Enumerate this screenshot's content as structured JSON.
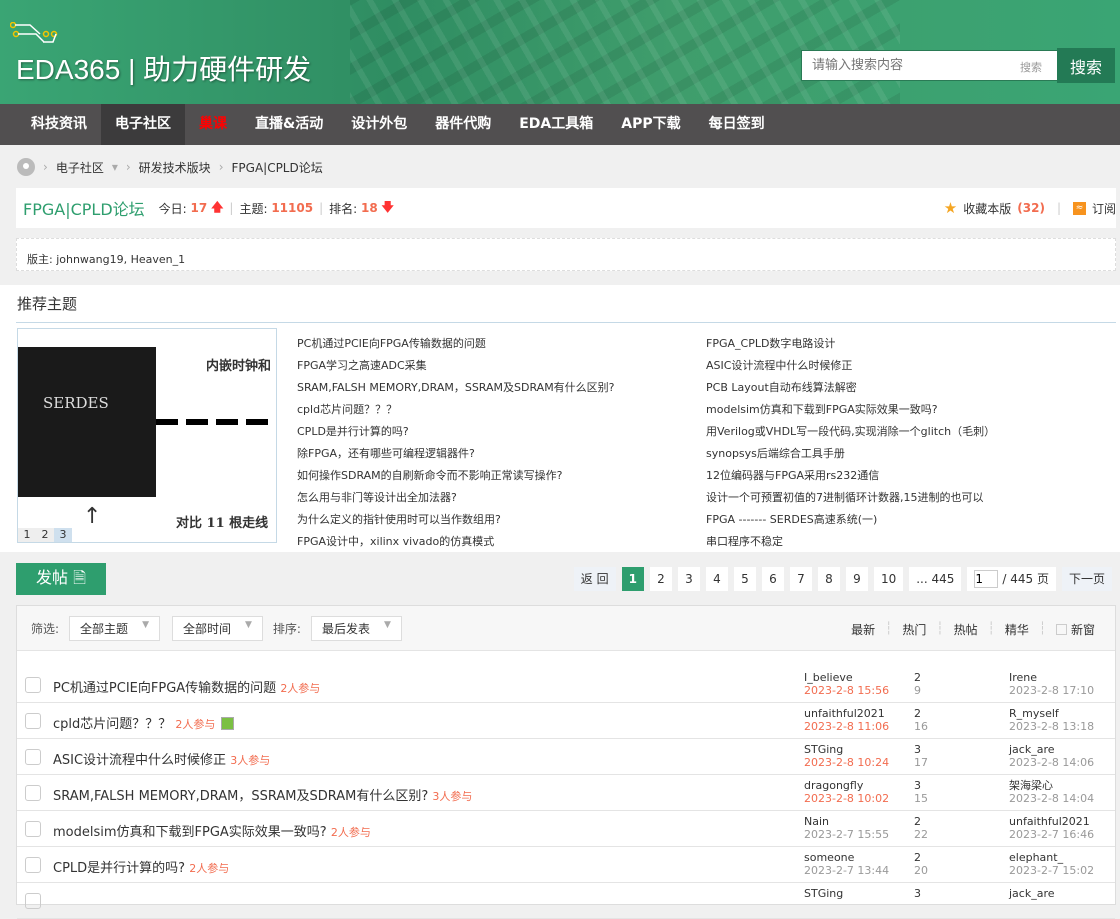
{
  "header": {
    "logo": "EDA365 | 助力硬件研发",
    "search_placeholder": "请输入搜索内容",
    "search_mini": "搜索",
    "search_button": "搜索"
  },
  "nav": [
    "科技资讯",
    "电子社区",
    "巢课",
    "直播&活动",
    "设计外包",
    "器件代购",
    "EDA工具箱",
    "APP下载",
    "每日签到"
  ],
  "breadcrumb": [
    "电子社区",
    "研发技术版块",
    "FPGA|CPLD论坛"
  ],
  "forum": {
    "title": "FPGA|CPLD论坛",
    "today_label": "今日:",
    "today": "17",
    "topics_label": "主题:",
    "topics": "11105",
    "rank_label": "排名:",
    "rank": "18",
    "fav": "收藏本版",
    "fav_count": "(32)",
    "subscribe": "订阅",
    "moderators": "版主: johnwang19, Heaven_1"
  },
  "recommend": {
    "title": "推荐主题",
    "img_text1": "SERDES",
    "img_text2": "内嵌时钟和",
    "img_text3": "对比 11 根走线",
    "img_pages": [
      "1",
      "2",
      "3"
    ],
    "col1": [
      "PC机通过PCIE向FPGA传输数据的问题",
      "FPGA学习之高速ADC采集",
      "SRAM,FALSH MEMORY,DRAM，SSRAM及SDRAM有什么区别?",
      "cpld芯片问题？？？",
      "CPLD是并行计算的吗?",
      "除FPGA，还有哪些可编程逻辑器件?",
      "如何操作SDRAM的自刷新命令而不影响正常读写操作?",
      "怎么用与非门等设计出全加法器?",
      "为什么定义的指针使用时可以当作数组用?",
      "FPGA设计中，xilinx vivado的仿真模式"
    ],
    "col2": [
      "FPGA_CPLD数字电路设计",
      "ASIC设计流程中什么时候修正",
      "PCB Layout自动布线算法解密",
      "modelsim仿真和下载到FPGA实际效果一致吗?",
      "用Verilog或VHDL写一段代码,实现消除一个glitch（毛刺）",
      "synopsys后端综合工具手册",
      "12位编码器与FPGA采用rs232通信",
      "设计一个可预置初值的7进制循环计数器,15进制的也可以",
      "FPGA ------- SERDES高速系统(一)",
      "串口程序不稳定"
    ]
  },
  "post_button": "发帖",
  "pagination": {
    "back": "返 回",
    "pages": [
      "1",
      "2",
      "3",
      "4",
      "5",
      "6",
      "7",
      "8",
      "9",
      "10",
      "... 445"
    ],
    "input": "1",
    "total": "/ 445 页",
    "next": "下一页"
  },
  "filter": {
    "label": "筛选:",
    "type": "全部主题",
    "time": "全部时间",
    "sort_label": "排序:",
    "sort": "最后发表",
    "tabs": [
      "最新",
      "热门",
      "热帖",
      "精华"
    ],
    "newwin": "新窗"
  },
  "threads": [
    {
      "title": "PC机通过PCIE向FPGA传输数据的问题",
      "part": "2人参与",
      "author": "I_believe",
      "date": "2023-2-8 15:56",
      "new": true,
      "replies": "2",
      "views": "9",
      "last": "Irene",
      "last_date": "2023-2-8 17:10"
    },
    {
      "title": "cpld芯片问题？？？",
      "part": "2人参与",
      "img": true,
      "author": "unfaithful2021",
      "date": "2023-2-8 11:06",
      "new": true,
      "replies": "2",
      "views": "16",
      "last": "R_myself",
      "last_date": "2023-2-8 13:18"
    },
    {
      "title": "ASIC设计流程中什么时候修正",
      "part": "3人参与",
      "author": "STGing",
      "date": "2023-2-8 10:24",
      "new": true,
      "replies": "3",
      "views": "17",
      "last": "jack_are",
      "last_date": "2023-2-8 14:06"
    },
    {
      "title": "SRAM,FALSH MEMORY,DRAM，SSRAM及SDRAM有什么区别?",
      "part": "3人参与",
      "author": "dragongfly",
      "date": "2023-2-8 10:02",
      "new": true,
      "replies": "3",
      "views": "15",
      "last": "架海梁心",
      "last_date": "2023-2-8 14:04"
    },
    {
      "title": "modelsim仿真和下载到FPGA实际效果一致吗?",
      "part": "2人参与",
      "author": "Nain",
      "date": "2023-2-7 15:55",
      "new": false,
      "replies": "2",
      "views": "22",
      "last": "unfaithful2021",
      "last_date": "2023-2-7 16:46"
    },
    {
      "title": "CPLD是并行计算的吗?",
      "part": "2人参与",
      "author": "someone",
      "date": "2023-2-7 13:44",
      "new": false,
      "replies": "2",
      "views": "20",
      "last": "elephant_",
      "last_date": "2023-2-7 15:02"
    },
    {
      "title": "",
      "part": "",
      "author": "STGing",
      "date": "",
      "new": false,
      "replies": "3",
      "views": "",
      "last": "jack_are",
      "last_date": ""
    }
  ],
  "colors": {
    "green": "#2e9e6e",
    "red": "#f26c4f",
    "nav": "#514f50"
  }
}
